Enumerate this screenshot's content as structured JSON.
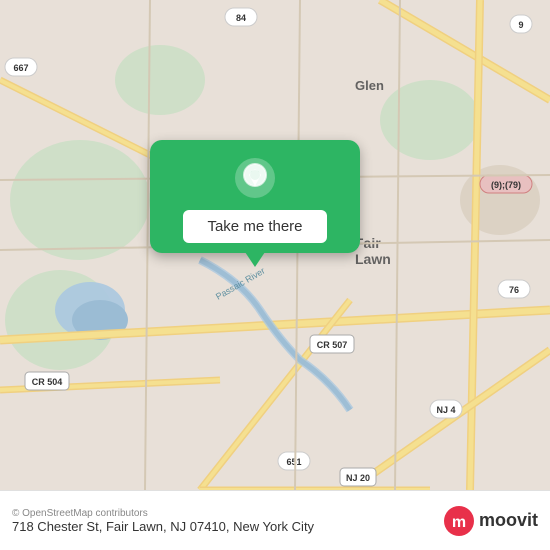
{
  "map": {
    "background_color": "#e8e0d8",
    "pin_color": "#2db563",
    "button_label": "Take me there"
  },
  "footer": {
    "osm_credit": "© OpenStreetMap contributors",
    "address": "718 Chester St, Fair Lawn, NJ 07410,",
    "city": "New York City",
    "brand": "moovit"
  }
}
